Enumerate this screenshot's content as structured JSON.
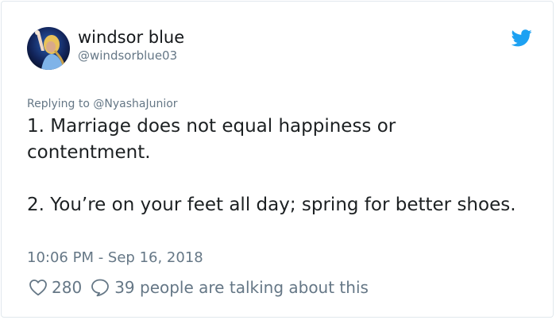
{
  "author": {
    "display_name": "windsor blue",
    "handle": "@windsorblue03"
  },
  "reply": {
    "prefix": "Replying to ",
    "to_handle": "@NyashaJunior"
  },
  "tweet": {
    "paragraph_1": "1. Marriage does not equal happiness or contentment.",
    "paragraph_2": "2. You’re on your feet all day; spring for better shoes."
  },
  "timestamp": "10:06 PM - Sep 16, 2018",
  "engagement": {
    "likes": "280",
    "talking": "39 people are talking about this"
  },
  "colors": {
    "brand": "#1da1f2",
    "secondary_text": "#657786",
    "primary_text": "#1c2022"
  },
  "icons": {
    "brand": "twitter-bird-icon",
    "like": "heart-icon",
    "talk": "speech-bubble-icon"
  }
}
